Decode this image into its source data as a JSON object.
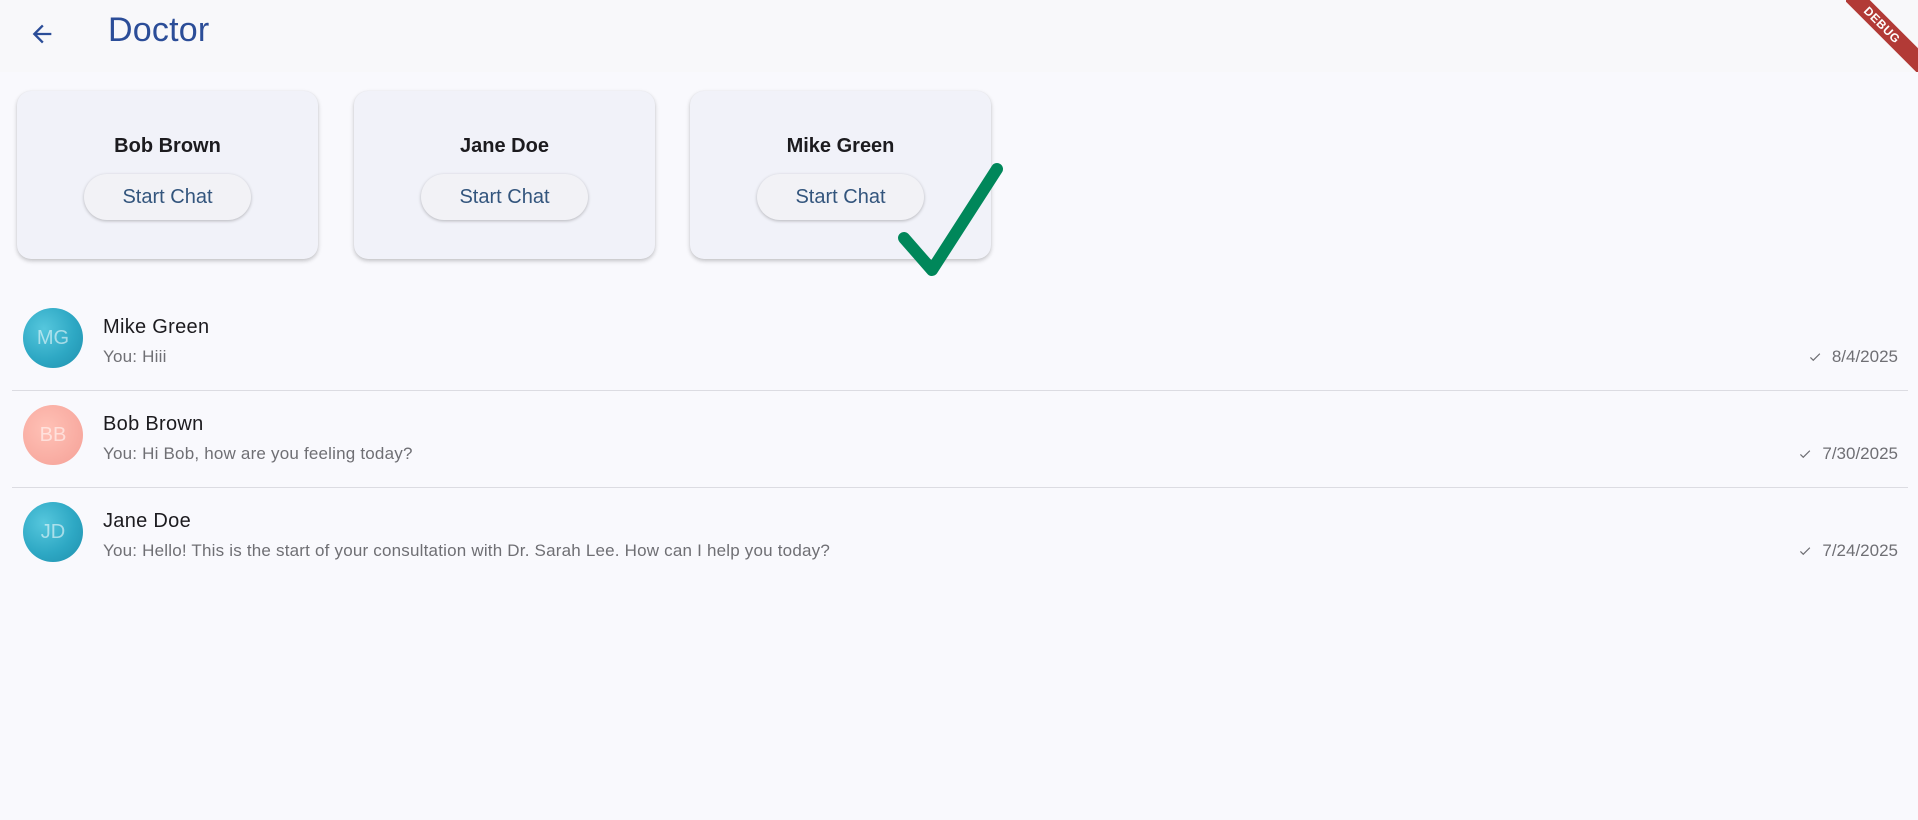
{
  "app_bar": {
    "title": "Doctor",
    "back_icon": "arrow-left-icon",
    "debug_label": "DEBUG",
    "title_color": "#2b4d98"
  },
  "doctor_cards": [
    {
      "name": "Bob Brown",
      "button_label": "Start Chat"
    },
    {
      "name": "Jane Doe",
      "button_label": "Start Chat"
    },
    {
      "name": "Mike Green",
      "button_label": "Start Chat"
    }
  ],
  "chats": [
    {
      "initials": "MG",
      "name": "Mike Green",
      "message": "You: Hiii",
      "date": "8/4/2025",
      "avatar_color": "#3fb4cf"
    },
    {
      "initials": "BB",
      "name": "Bob Brown",
      "message": "You: Hi Bob, how are you feeling today?",
      "date": "7/30/2025",
      "avatar_color": "#f8aaa0"
    },
    {
      "initials": "JD",
      "name": "Jane Doe",
      "message": "You: Hello! This is the start of your consultation with Dr. Sarah Lee. How can I help you today?",
      "date": "7/24/2025",
      "avatar_color": "#3fb4cf"
    }
  ],
  "overlay": {
    "icon": "checkmark-icon",
    "color": "#00875a"
  }
}
